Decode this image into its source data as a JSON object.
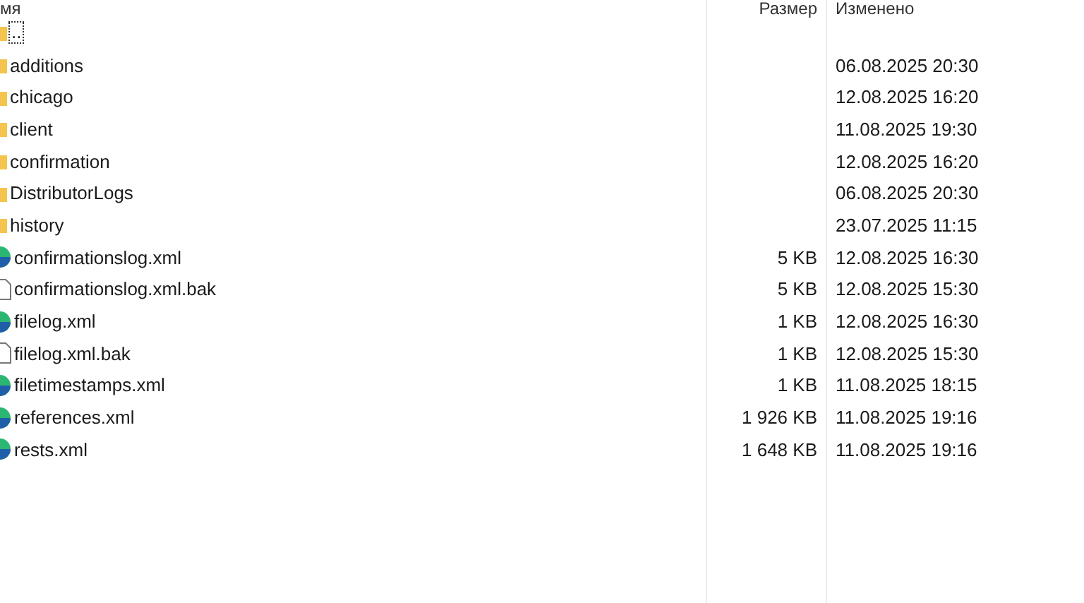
{
  "columns": [
    {
      "label": "мя"
    },
    {
      "label": "Размер"
    },
    {
      "label": "Изменено"
    }
  ],
  "rows": [
    {
      "kind": "parent",
      "name": "..",
      "focused": true
    },
    {
      "kind": "folder",
      "name": "additions",
      "modified": "06.08.2025 20:30"
    },
    {
      "kind": "folder",
      "name": "chicago",
      "modified": "12.08.2025 16:20"
    },
    {
      "kind": "folder",
      "name": "client",
      "modified": "11.08.2025 19:30"
    },
    {
      "kind": "folder",
      "name": "confirmation",
      "modified": "12.08.2025 16:20"
    },
    {
      "kind": "folder",
      "name": "DistributorLogs",
      "modified": "06.08.2025 20:30"
    },
    {
      "kind": "folder",
      "name": "history",
      "modified": "23.07.2025 11:15"
    },
    {
      "kind": "xml",
      "name": "confirmationslog.xml",
      "size": "5 KB",
      "modified": "12.08.2025 16:30"
    },
    {
      "kind": "file",
      "name": "confirmationslog.xml.bak",
      "size": "5 KB",
      "modified": "12.08.2025 15:30"
    },
    {
      "kind": "xml",
      "name": "filelog.xml",
      "size": "1 KB",
      "modified": "12.08.2025 16:30"
    },
    {
      "kind": "file",
      "name": "filelog.xml.bak",
      "size": "1 KB",
      "modified": "12.08.2025 15:30"
    },
    {
      "kind": "xml",
      "name": "filetimestamps.xml",
      "size": "1 KB",
      "modified": "11.08.2025 18:15"
    },
    {
      "kind": "xml",
      "name": "references.xml",
      "size": "1 926 KB",
      "modified": "11.08.2025 19:16"
    },
    {
      "kind": "xml",
      "name": "rests.xml",
      "size": "1 648 KB",
      "modified": "11.08.2025 19:16"
    }
  ]
}
